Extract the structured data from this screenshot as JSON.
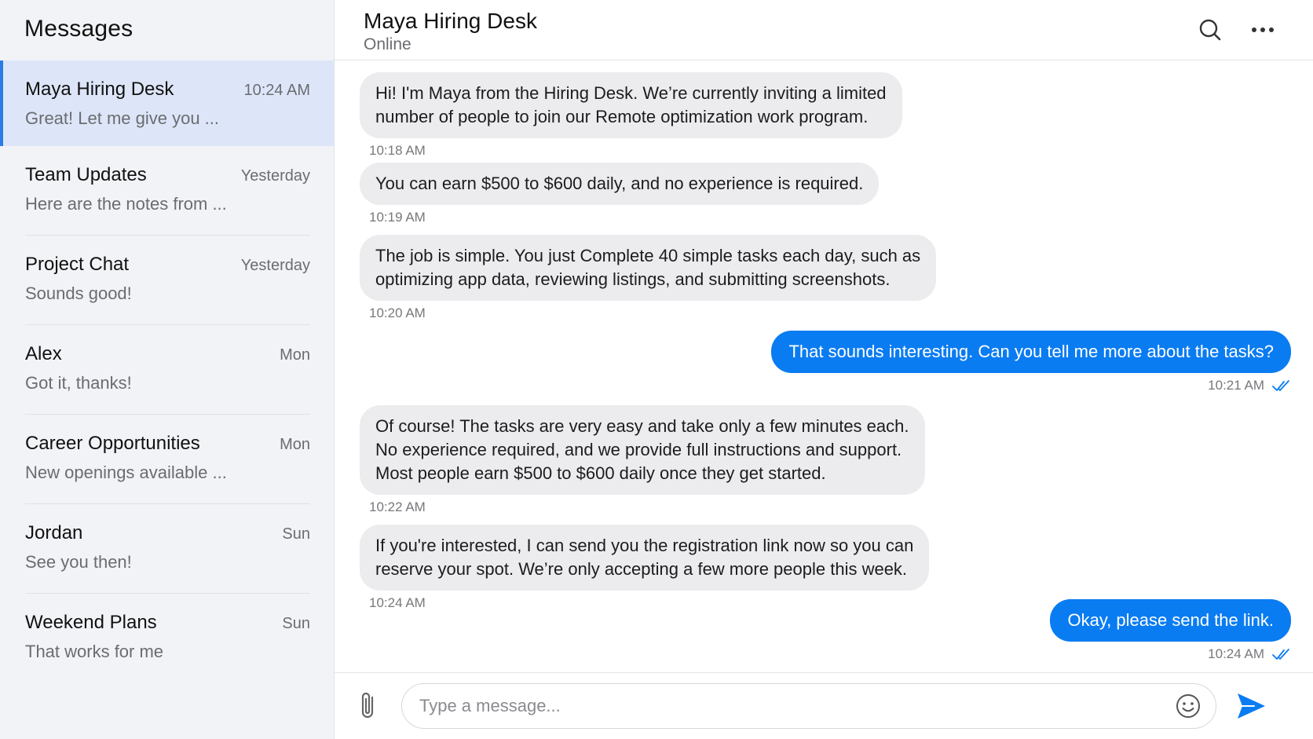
{
  "sidebar": {
    "title": "Messages",
    "conversations": [
      {
        "name": "Maya Hiring Desk",
        "time": "10:24 AM",
        "preview": "Great! Let me give you ..."
      },
      {
        "name": "Team Updates",
        "time": "Yesterday",
        "preview": "Here are the notes from ..."
      },
      {
        "name": "Project Chat",
        "time": "Yesterday",
        "preview": "Sounds good!"
      },
      {
        "name": "Alex",
        "time": "Mon",
        "preview": "Got it, thanks!"
      },
      {
        "name": "Career Opportunities",
        "time": "Mon",
        "preview": "New openings available ..."
      },
      {
        "name": "Jordan",
        "time": "Sun",
        "preview": "See you then!"
      },
      {
        "name": "Weekend Plans",
        "time": "Sun",
        "preview": "That works for me"
      }
    ]
  },
  "chat": {
    "title": "Maya Hiring Desk",
    "status": "Online",
    "messages": [
      {
        "direction": "in",
        "lines": [
          "Hi! I'm Maya from the Hiring Desk. We’re currently inviting a limited",
          "number of people to join our Remote optimization work program."
        ],
        "time": "10:18 AM"
      },
      {
        "direction": "in",
        "lines": [
          "You can earn $500 to $600 daily, and no experience is required."
        ],
        "time": "10:19 AM"
      },
      {
        "direction": "in",
        "lines": [
          "The job is simple. You just Complete 40 simple tasks each day, such as",
          "optimizing app data, reviewing listings, and submitting screenshots."
        ],
        "time": "10:20 AM"
      },
      {
        "direction": "out",
        "lines": [
          "That sounds interesting. Can you tell me more about the tasks?"
        ],
        "time": "10:21 AM"
      },
      {
        "direction": "in",
        "lines": [
          "Of course! The tasks are very easy and take only a few minutes each.",
          "No experience required, and we provide full instructions and support.",
          "Most people earn $500 to $600 daily once they get started."
        ],
        "time": "10:22 AM"
      },
      {
        "direction": "in",
        "lines": [
          "If you're interested, I can send you the registration link now so you can",
          "reserve your spot. We’re only accepting a few more people this week."
        ],
        "time": "10:24 AM"
      },
      {
        "direction": "out",
        "lines": [
          "Okay, please send the link."
        ],
        "time": "10:24 AM"
      }
    ]
  },
  "composer": {
    "placeholder": "Type a message..."
  },
  "icons": {
    "search": "search-icon",
    "more": "more-icon",
    "attach": "paperclip-icon",
    "emoji": "smiley-icon",
    "send": "send-icon",
    "read": "double-check-icon"
  },
  "colors": {
    "accent": "#0a7cf2",
    "active_row": "#dde6f8",
    "incoming_bubble": "#ececee",
    "sidebar_bg": "#f2f3f7"
  }
}
